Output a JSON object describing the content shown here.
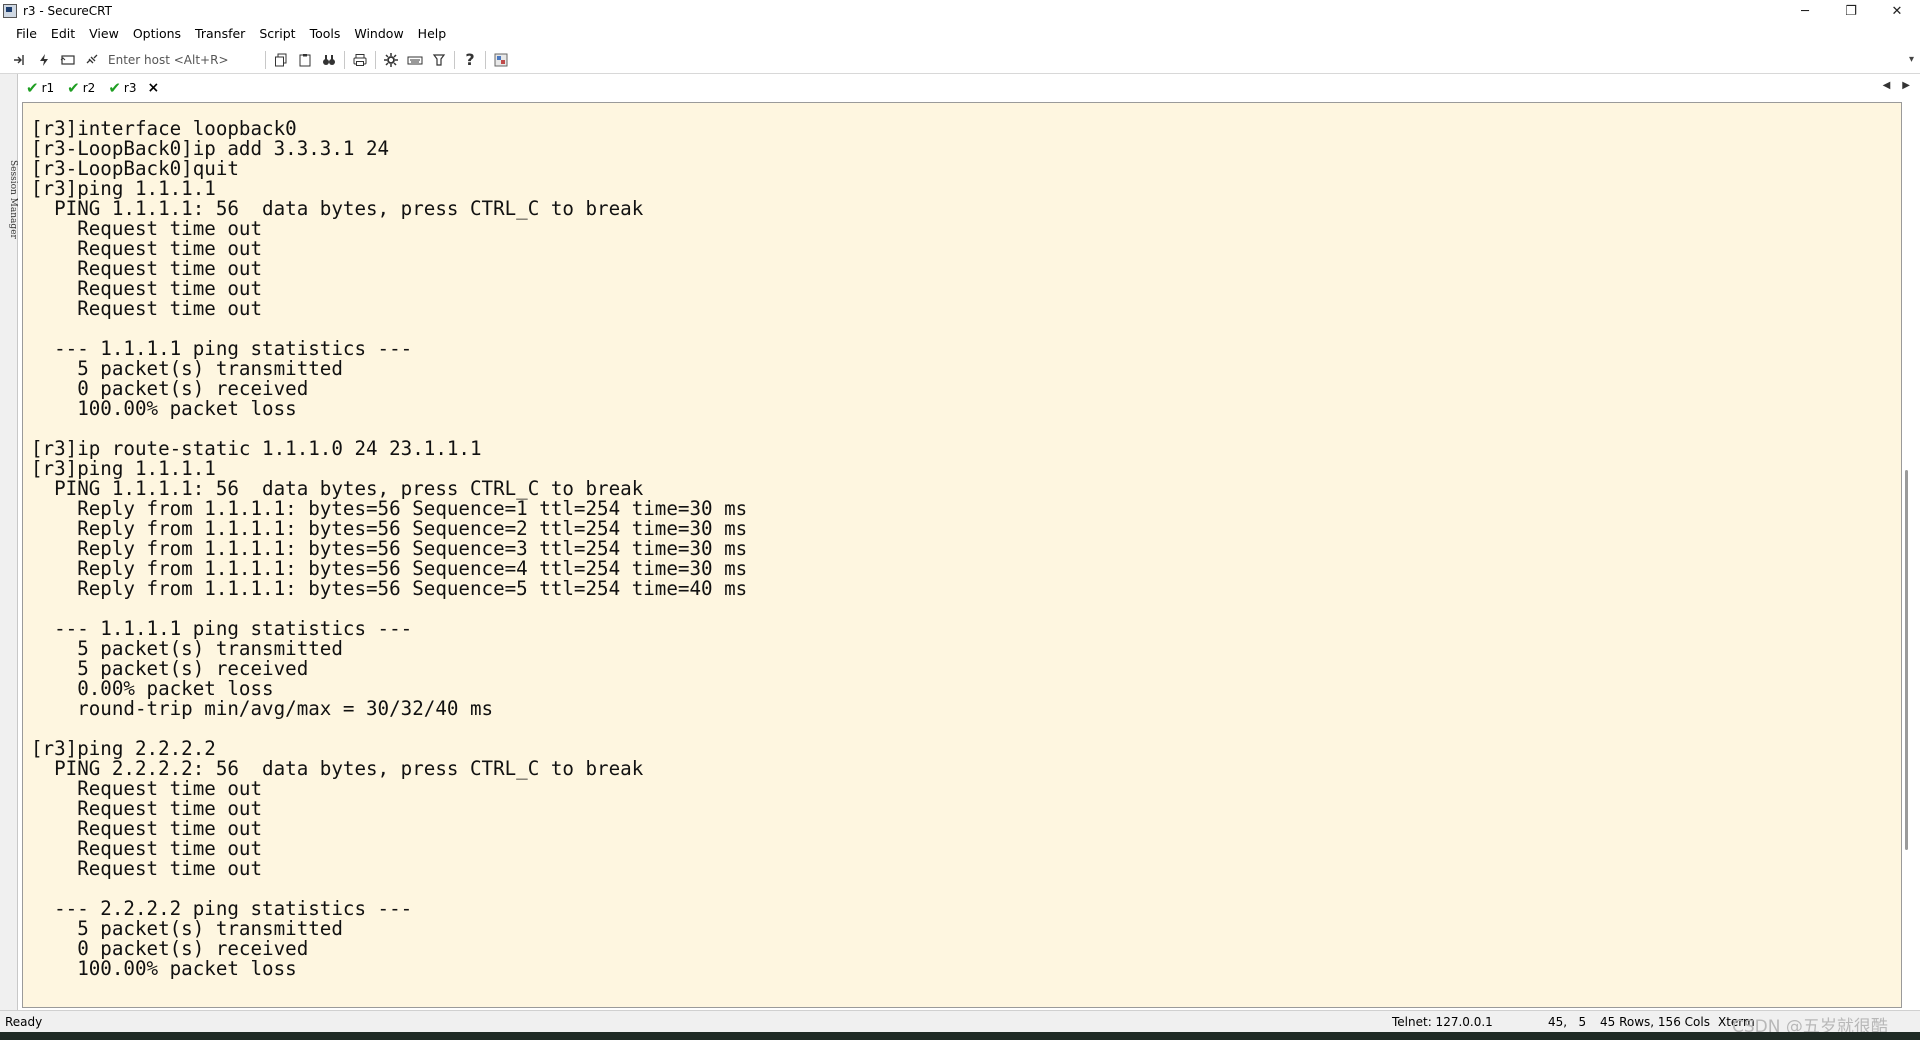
{
  "window": {
    "title": "r3 - SecureCRT",
    "minimize_glyph": "─",
    "restore_glyph": "❐",
    "close_glyph": "✕"
  },
  "menu": [
    "File",
    "Edit",
    "View",
    "Options",
    "Transfer",
    "Script",
    "Tools",
    "Window",
    "Help"
  ],
  "toolbar": {
    "host_placeholder": "Enter host <Alt+R>",
    "icons": [
      "connect-icon",
      "quick-connect-icon",
      "reconnect-icon",
      "disconnect-icon",
      "copy-icon",
      "paste-icon",
      "find-icon",
      "print-icon",
      "settings-icon",
      "keymap-icon",
      "sftp-icon",
      "help-icon",
      "screenshot-icon"
    ]
  },
  "side_panel": {
    "label": "Session Manager"
  },
  "tabs": [
    {
      "label": "r1",
      "status": "connected"
    },
    {
      "label": "r2",
      "status": "connected"
    },
    {
      "label": "r3",
      "status": "connected"
    }
  ],
  "tab_close_glyph": "×",
  "terminal": {
    "background": "#fef6e0",
    "text": "[r3]interface loopback0\n[r3-LoopBack0]ip add 3.3.3.1 24\n[r3-LoopBack0]quit\n[r3]ping 1.1.1.1\n  PING 1.1.1.1: 56  data bytes, press CTRL_C to break\n    Request time out\n    Request time out\n    Request time out\n    Request time out\n    Request time out\n\n  --- 1.1.1.1 ping statistics ---\n    5 packet(s) transmitted\n    0 packet(s) received\n    100.00% packet loss\n\n[r3]ip route-static 1.1.1.0 24 23.1.1.1\n[r3]ping 1.1.1.1\n  PING 1.1.1.1: 56  data bytes, press CTRL_C to break\n    Reply from 1.1.1.1: bytes=56 Sequence=1 ttl=254 time=30 ms\n    Reply from 1.1.1.1: bytes=56 Sequence=2 ttl=254 time=30 ms\n    Reply from 1.1.1.1: bytes=56 Sequence=3 ttl=254 time=30 ms\n    Reply from 1.1.1.1: bytes=56 Sequence=4 ttl=254 time=30 ms\n    Reply from 1.1.1.1: bytes=56 Sequence=5 ttl=254 time=40 ms\n\n  --- 1.1.1.1 ping statistics ---\n    5 packet(s) transmitted\n    5 packet(s) received\n    0.00% packet loss\n    round-trip min/avg/max = 30/32/40 ms\n\n[r3]ping 2.2.2.2\n  PING 2.2.2.2: 56  data bytes, press CTRL_C to break\n    Request time out\n    Request time out\n    Request time out\n    Request time out\n    Request time out\n\n  --- 2.2.2.2 ping statistics ---\n    5 packet(s) transmitted\n    0 packet(s) received\n    100.00% packet loss"
  },
  "status_bar": {
    "state": "Ready",
    "connection": "Telnet: 127.0.0.1",
    "cursor": "45,   5",
    "size": "45 Rows, 156 Cols",
    "terminal_type": "Xterm",
    "watermark": "CSDN @五岁就很酷"
  }
}
